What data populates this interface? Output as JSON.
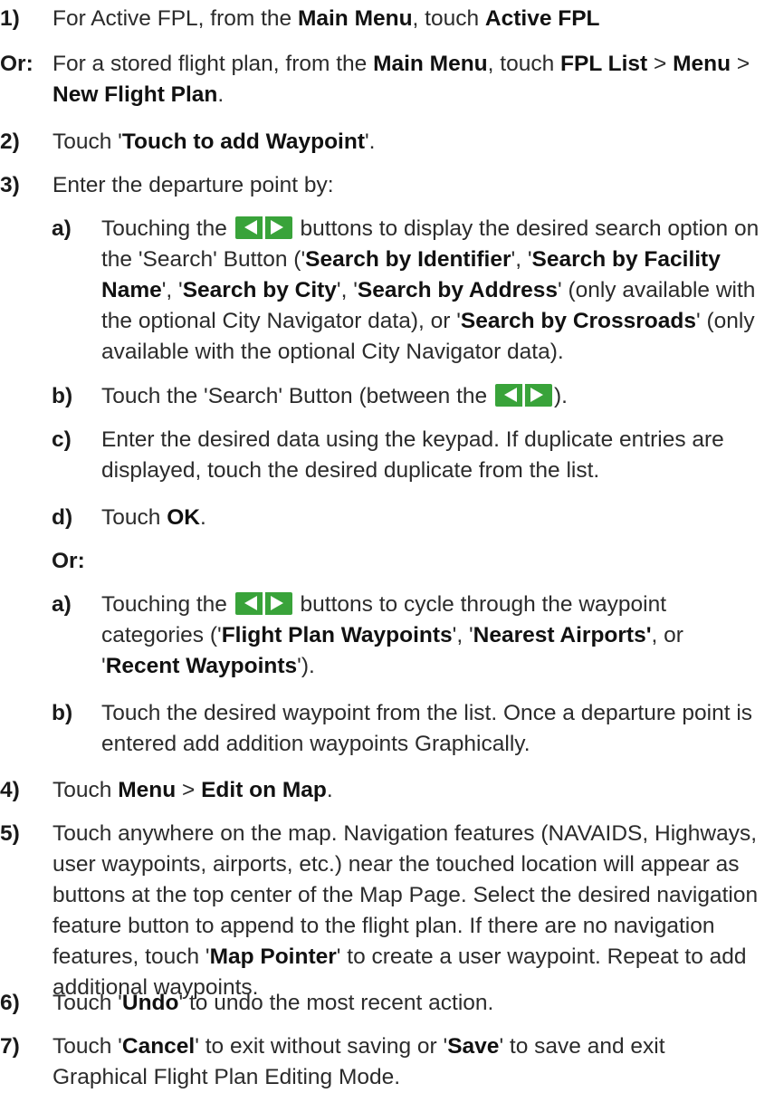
{
  "steps": {
    "s1": {
      "num": "1)",
      "a": "For Active FPL, from the ",
      "b1": "Main Menu",
      "c": ", touch ",
      "b2": "Active FPL"
    },
    "or1": {
      "num": "Or:",
      "a": "For a stored flight plan, from the ",
      "b1": "Main Menu",
      "c": ", touch ",
      "b2": "FPL List",
      "d": " > ",
      "b3": "Menu",
      "e": " > ",
      "b4": "New Flight Plan",
      "f": "."
    },
    "s2": {
      "num": "2)",
      "a": "Touch '",
      "b1": "Touch to add Waypoint",
      "c": "'."
    },
    "s3": {
      "num": "3)",
      "a": "Enter the departure point by:"
    },
    "s3a": {
      "num": "a)",
      "a": "Touching the ",
      "b": " buttons to display the desired search option on the 'Search' Button ('",
      "b1": "Search by Identifier",
      "c": "', '",
      "b2": "Search by Facility Name",
      "d": "', '",
      "b3": "Search by City",
      "e": "',  '",
      "b4": "Search by Address",
      "f": "' (only available with the optional City Navigator data), or '",
      "b5": "Search by Crossroads",
      "g": "' (only available with the optional City Navigator data)."
    },
    "s3b": {
      "num": "b)",
      "a": "Touch the 'Search' Button (between the ",
      "b": ")."
    },
    "s3c": {
      "num": "c)",
      "a": "Enter the desired data using the keypad.  If duplicate entries are displayed, touch the desired duplicate from the list."
    },
    "s3d": {
      "num": "d)",
      "a": "Touch ",
      "b1": "OK",
      "c": "."
    },
    "or2": {
      "num": "Or:"
    },
    "s3a2": {
      "num": "a)",
      "a": "Touching the ",
      "b": " buttons to cycle through the waypoint categories ('",
      "b1": "Flight Plan Waypoints",
      "c": "', '",
      "b2": "Nearest Airports'",
      "d": ", or '",
      "b3": "Recent Waypoints",
      "e": "')."
    },
    "s3b2": {
      "num": "b)",
      "a": "Touch the desired waypoint from the list. Once a departure point is entered add addition waypoints Graphically."
    },
    "s4": {
      "num": "4)",
      "a": "Touch ",
      "b1": "Menu",
      "c": " > ",
      "b2": "Edit on Map",
      "d": "."
    },
    "s5": {
      "num": "5)",
      "a": "Touch anywhere on the map.  Navigation features (NAVAIDS, Highways, user waypoints, airports, etc.) near the touched location will appear as buttons at the top center of the Map Page.  Select the desired navigation feature button to append to the flight plan.  If there are no navigation features, touch '",
      "b1": "Map Pointer",
      "c": "' to create a user waypoint.  Repeat to add additional waypoints."
    },
    "s6": {
      "num": "6)",
      "a": "Touch '",
      "b1": "Undo",
      "c": "' to undo the most recent action."
    },
    "s7": {
      "num": "7)",
      "a": "Touch '",
      "b1": "Cancel",
      "c": "' to exit without saving or '",
      "b2": "Save",
      "d": "' to save and exit Graphical Flight Plan Editing Mode."
    }
  },
  "icons": {
    "arrows": "left-right-arrow-buttons-icon",
    "arrow_color": "#39a33a"
  }
}
